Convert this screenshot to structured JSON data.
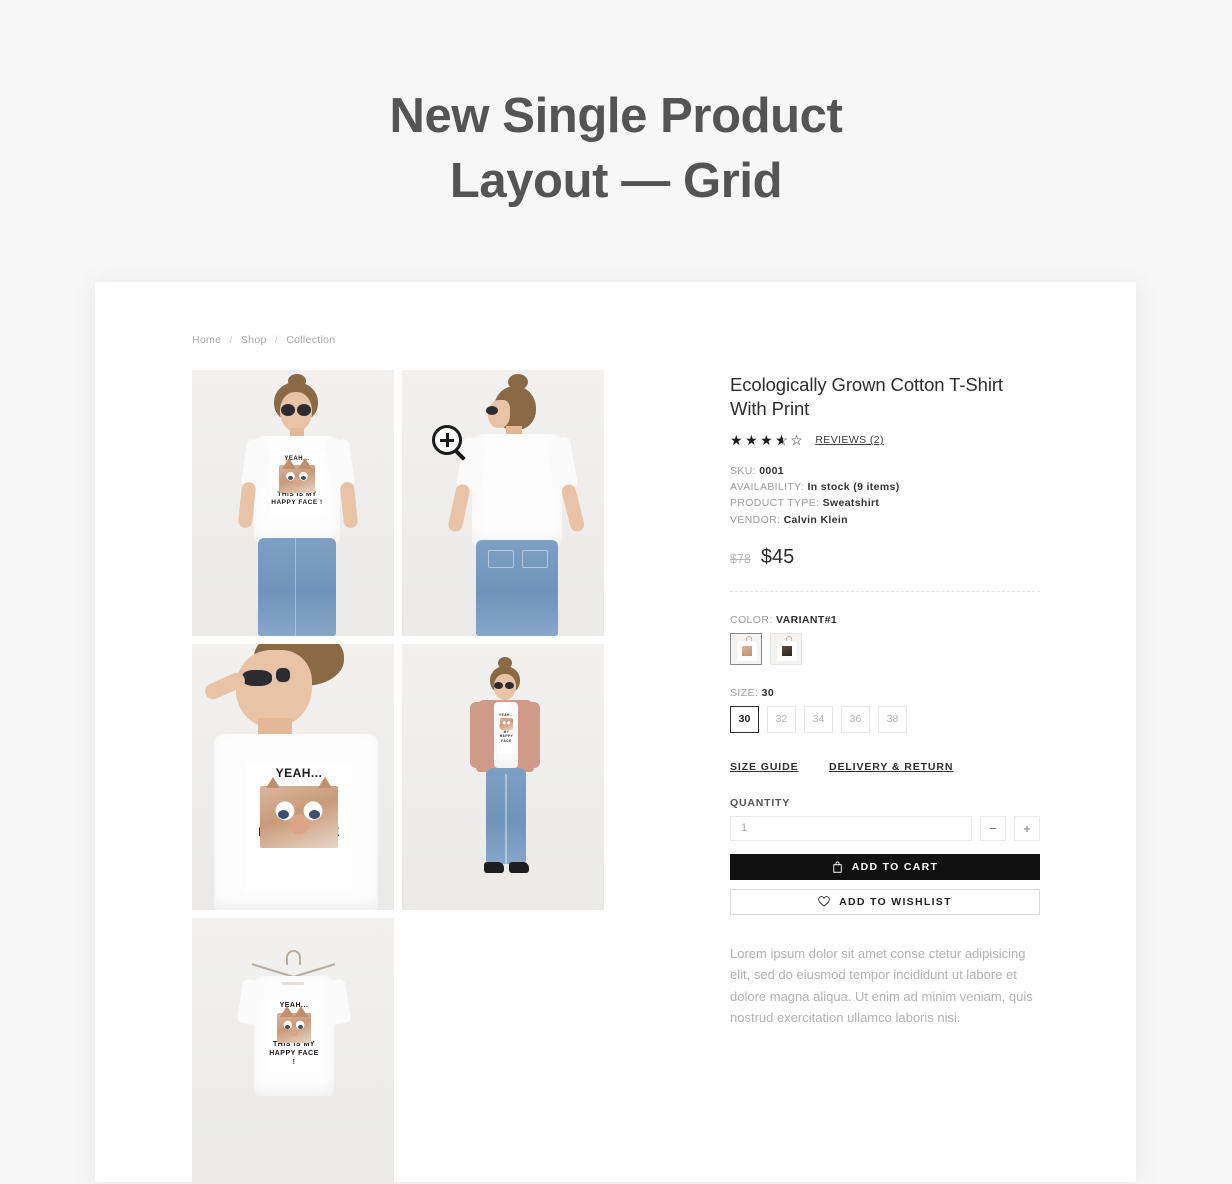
{
  "heading": {
    "line1": "New Single Product",
    "line2": "Layout — Grid"
  },
  "breadcrumb": {
    "items": [
      "Home",
      "Shop",
      "Collection"
    ],
    "separator": "/"
  },
  "gallery": {
    "zoom_icon": "magnifier-plus-icon",
    "images": [
      {
        "alt": "Model front view wearing white cat print t-shirt and blue jeans"
      },
      {
        "alt": "Model back view wearing plain white t-shirt and blue jeans"
      },
      {
        "alt": "Close up of cat print t-shirt on model with sunglasses"
      },
      {
        "alt": "Full body model in pink coat, cat print t-shirt, jeans and sneakers"
      },
      {
        "alt": "White cat print t-shirt on a hanger flat lay"
      }
    ],
    "print_text": {
      "top": "YEAH...",
      "bottom_line1": "THIS IS MY",
      "bottom_line2": "HAPPY FACE !"
    }
  },
  "product": {
    "title": "Ecologically Grown Cotton T-Shirt With Print",
    "rating": {
      "value": 3.5,
      "max": 5,
      "full_star": "★",
      "empty_star": "☆",
      "reviews_label": "REVIEWS (2)",
      "reviews_count": 2
    },
    "meta": [
      {
        "label": "SKU:",
        "value": "0001"
      },
      {
        "label": "AVAILABILITY:",
        "value": "In stock (9 items)"
      },
      {
        "label": "PRODUCT TYPE:",
        "value": "Sweatshirt"
      },
      {
        "label": "VENDOR:",
        "value": "Calvin Klein"
      }
    ],
    "price": {
      "old": "$78",
      "current": "$45"
    },
    "color": {
      "label": "COLOR:",
      "selected": "VARIANT#1",
      "options": [
        {
          "name": "VARIANT#1",
          "selected": true
        },
        {
          "name": "VARIANT#2",
          "selected": false
        }
      ]
    },
    "size": {
      "label": "SIZE:",
      "selected": "30",
      "options": [
        "30",
        "32",
        "34",
        "36",
        "38"
      ]
    },
    "links": [
      {
        "label": "SIZE GUIDE"
      },
      {
        "label": "DELIVERY & RETURN"
      }
    ],
    "quantity": {
      "label": "QUANTITY",
      "value": "1",
      "placeholder": "1",
      "decrement": "−",
      "increment": "+"
    },
    "actions": {
      "add_to_cart": "ADD TO CART",
      "add_to_cart_icon": "shopping-bag-icon",
      "add_to_wishlist": "ADD TO WISHLIST",
      "add_to_wishlist_icon": "heart-icon"
    },
    "description": "Lorem ipsum dolor sit amet conse ctetur adipisicing elit, sed do eiusmod tempor incididunt ut labore et dolore magna aliqua. Ut enim ad minim veniam, quis nostrud exercitation ullamco laboris nisi."
  },
  "colors": {
    "page_background": "#f7f7f7",
    "card_background": "#ffffff",
    "heading_text": "#545454",
    "title_text": "#2e2e2e",
    "muted_text": "#9d9d9d",
    "description_text": "#b2b2b2",
    "cart_button_bg": "#111111",
    "border": "#e6e6e6"
  }
}
